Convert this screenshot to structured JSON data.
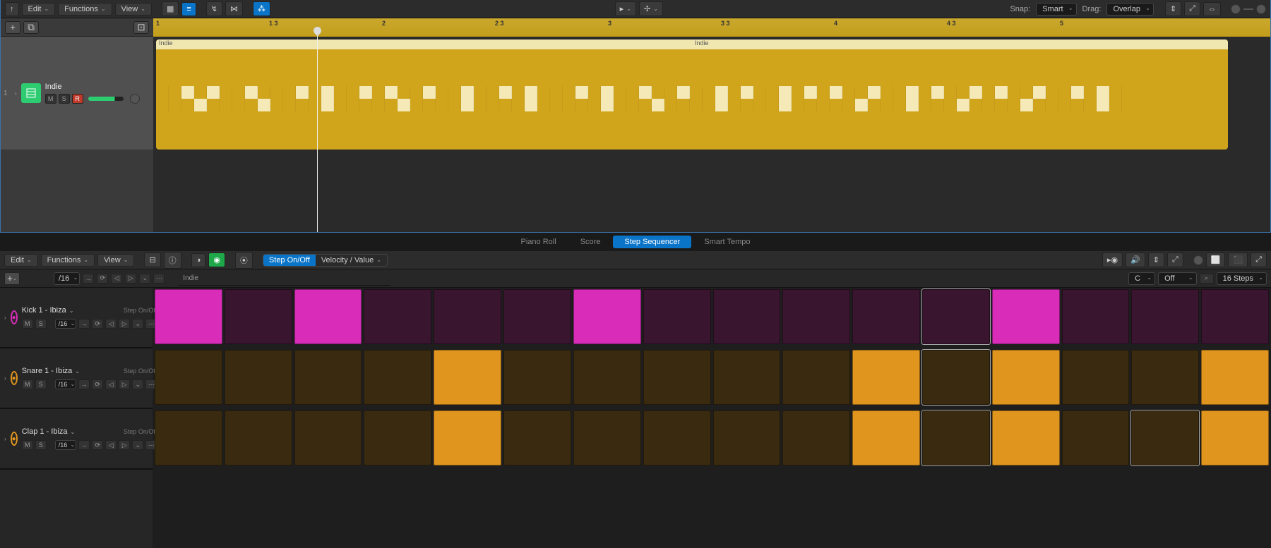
{
  "top_toolbar": {
    "edit": "Edit",
    "functions": "Functions",
    "view": "View",
    "snap_label": "Snap:",
    "snap_value": "Smart",
    "drag_label": "Drag:",
    "drag_value": "Overlap"
  },
  "track": {
    "index": "1",
    "name": "Indie",
    "mute": "M",
    "solo": "S",
    "rec": "R"
  },
  "ruler_marks": [
    {
      "pos": 0,
      "label": "1"
    },
    {
      "pos": 160,
      "label": "1 3"
    },
    {
      "pos": 320,
      "label": "2"
    },
    {
      "pos": 480,
      "label": "2 3"
    },
    {
      "pos": 640,
      "label": "3"
    },
    {
      "pos": 800,
      "label": "3 3"
    },
    {
      "pos": 960,
      "label": "4"
    },
    {
      "pos": 1120,
      "label": "4 3"
    },
    {
      "pos": 1280,
      "label": "5"
    }
  ],
  "region": {
    "name_a": "Indie",
    "name_b": "Indie"
  },
  "tabs": {
    "piano": "Piano Roll",
    "score": "Score",
    "step": "Step Sequencer",
    "smart": "Smart Tempo"
  },
  "seq_toolbar": {
    "edit": "Edit",
    "functions": "Functions",
    "view": "View",
    "step_mode": "Step On/Off",
    "vel_mode": "Velocity / Value"
  },
  "seq_sub": {
    "division": "/16",
    "pattern_name": "Indie",
    "key": "C",
    "scale": "Off",
    "steps": "16 Steps"
  },
  "rows": [
    {
      "name": "Kick 1 - Ibiza",
      "mode": "Step On/Off",
      "color": "#d82cb9",
      "icon": "headphones",
      "steps": [
        1,
        0,
        1,
        0,
        0,
        0,
        1,
        0,
        0,
        0,
        0,
        0,
        1,
        0,
        0,
        0
      ],
      "hl": 11,
      "onc": "kick-on",
      "offc": "kick-off"
    },
    {
      "name": "Snare 1 - Ibiza",
      "mode": "Step On/Off",
      "color": "#e0951e",
      "icon": "drum",
      "steps": [
        0,
        0,
        0,
        0,
        1,
        0,
        0,
        0,
        0,
        0,
        1,
        0,
        1,
        0,
        0,
        1
      ],
      "hl": 11,
      "onc": "snare-on",
      "offc": "snare-off"
    },
    {
      "name": "Clap 1 - Ibiza",
      "mode": "Step On/Off",
      "color": "#e0951e",
      "icon": "clap",
      "steps": [
        0,
        0,
        0,
        0,
        1,
        0,
        0,
        0,
        0,
        0,
        1,
        0,
        1,
        0,
        0,
        1
      ],
      "hl": 11,
      "onc": "clap-on",
      "offc": "clap-off",
      "hl2": 14
    }
  ],
  "btns": {
    "mute": "M",
    "solo": "S",
    "div": "/16"
  }
}
